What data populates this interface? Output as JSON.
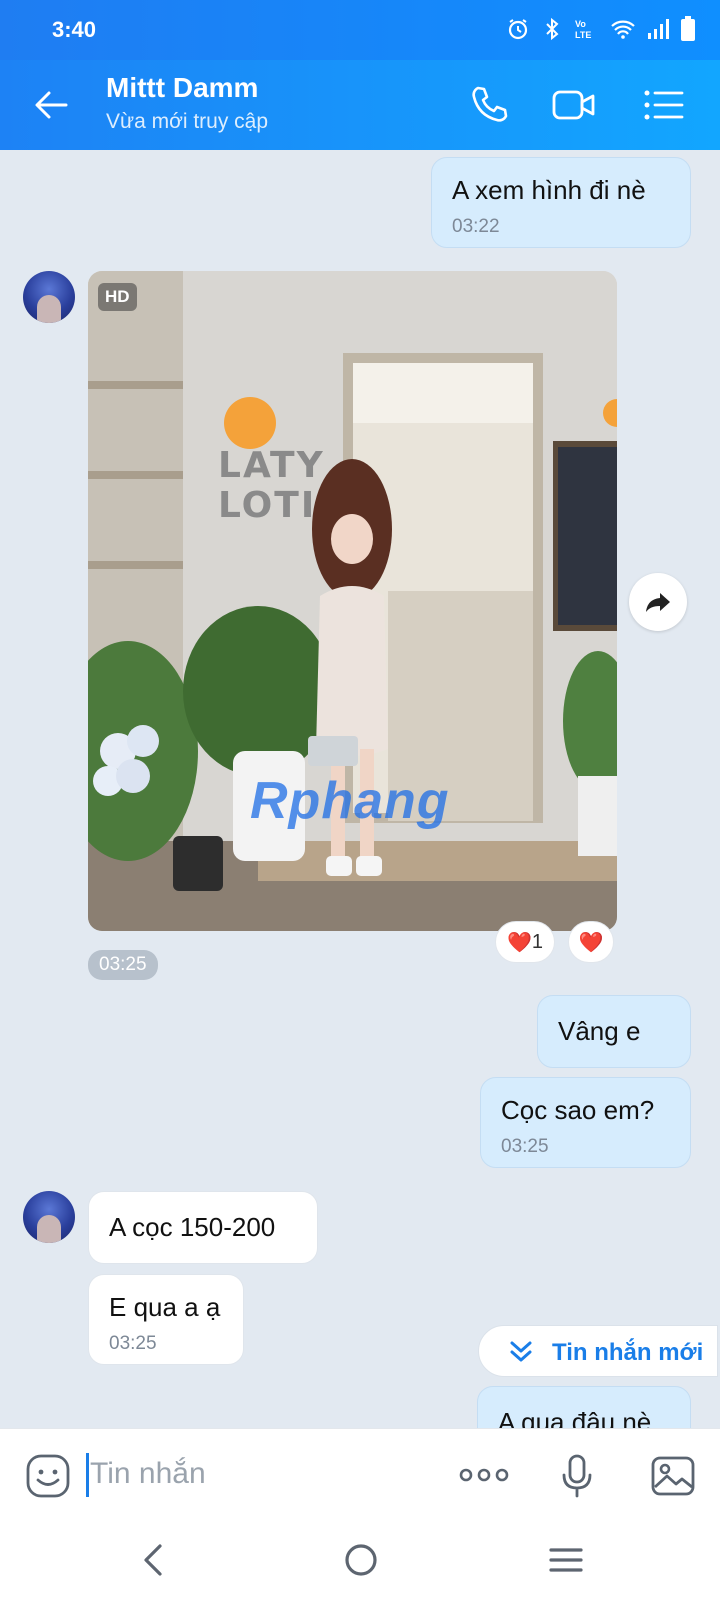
{
  "status_bar": {
    "time": "3:40"
  },
  "header": {
    "name": "Mittt Damm",
    "status": "Vừa mới truy cập"
  },
  "messages": [
    {
      "text": "A xem hình đi nè",
      "time": "03:22"
    },
    {
      "image": {
        "badge": "HD",
        "sign_line1": "LATY",
        "sign_line2": "LOTI",
        "watermark": "Rphang"
      },
      "time": "03:25",
      "reactions": [
        {
          "emoji": "❤️",
          "count": "1"
        },
        {
          "emoji": "❤️",
          "count": ""
        }
      ]
    },
    {
      "text": "Vâng e"
    },
    {
      "text": "Cọc sao em?",
      "time": "03:25"
    },
    {
      "text": "A cọc 150-200"
    },
    {
      "text": "E qua a ạ",
      "time": "03:25"
    },
    {
      "text": "A qua đâu nè"
    }
  ],
  "new_messages_button": "Tin nhắn mới",
  "input": {
    "placeholder": "Tin nhắn"
  }
}
